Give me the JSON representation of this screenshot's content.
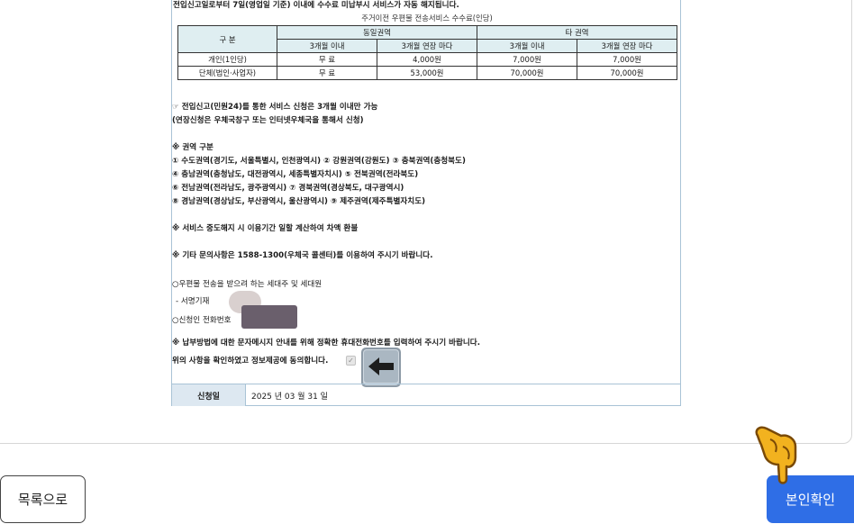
{
  "notice_top": "전입신고일로부터 7일(영업일 기준) 이내에 수수료 미납부시 서비스가 자동 해지됩니다.",
  "fee_table": {
    "caption": "주거이전 우편물 전송서비스 수수료(인당)",
    "header_category": "구 분",
    "header_same_region": "동일권역",
    "header_other_region": "타 권역",
    "sub_headers": [
      "3개월 이내",
      "3개월 연장 마다",
      "3개월 이내",
      "3개월 연장 마다"
    ],
    "rows": [
      {
        "label": "개인(1인당)",
        "values": [
          "무 료",
          "4,000원",
          "7,000원",
          "7,000원"
        ]
      },
      {
        "label": "단체(법인·사업자)",
        "values": [
          "무 료",
          "53,000원",
          "70,000원",
          "70,000원"
        ]
      }
    ]
  },
  "notes": {
    "apply_line1": "☞ 전입신고(민원24)를 통한 서비스 신청은 3개월 이내만 가능",
    "apply_line2": "(연장신청은 우체국창구 또는 인터넷우체국을 통해서 신청)",
    "region_title": "※ 권역 구분",
    "region_lines": [
      "① 수도권역(경기도, 서울특별시, 인천광역시) ② 강원권역(강원도) ③ 충북권역(충청북도)",
      "④ 충남권역(충청남도, 대전광역시, 세종특별자치시) ⑤ 전북권역(전라북도)",
      "⑥ 전남권역(전라남도, 광주광역시) ⑦ 경북권역(경상북도, 대구광역시)",
      "⑧ 경남권역(경상남도, 부산광역시, 울산광역시) ⑨ 제주권역(제주특별자치도)"
    ],
    "refund_note": "※ 서비스 중도해지 시 이용기간 일할 계산하여 차액 환불",
    "contact_note": "※ 기타 문의사항은 1588-1300(우체국 콜센터)를 이용하여 주시기 바랍니다.",
    "target_line": "○우편물 전송을 받으려 하는 세대주 및 세대원",
    "target_sub": "- 서명기재",
    "phone_line": "○신청인 전화번호",
    "sms_note": "※ 납부방법에 대한 문자메시지 안내를 위해 정확한 휴대전화번호를 입력하여 주시기 바랍니다.",
    "consent_label": "위의 사항을 확인하였고 정보제공에 동의합니다.",
    "consent_checked": true
  },
  "apply_date": {
    "label": "신청일",
    "value": "2025 년 03 월 31 일"
  },
  "buttons": {
    "list": "목록으로",
    "verify": "본인확인"
  },
  "icons": {
    "left_arrow": "left-arrow-emoji-icon",
    "pointing_hand": "pointing-hand-icon",
    "check": "✓"
  },
  "colors": {
    "primary_button": "#2f6ee6",
    "table_header_bg": "#dfeef1",
    "label_bg": "#dde8f1"
  }
}
